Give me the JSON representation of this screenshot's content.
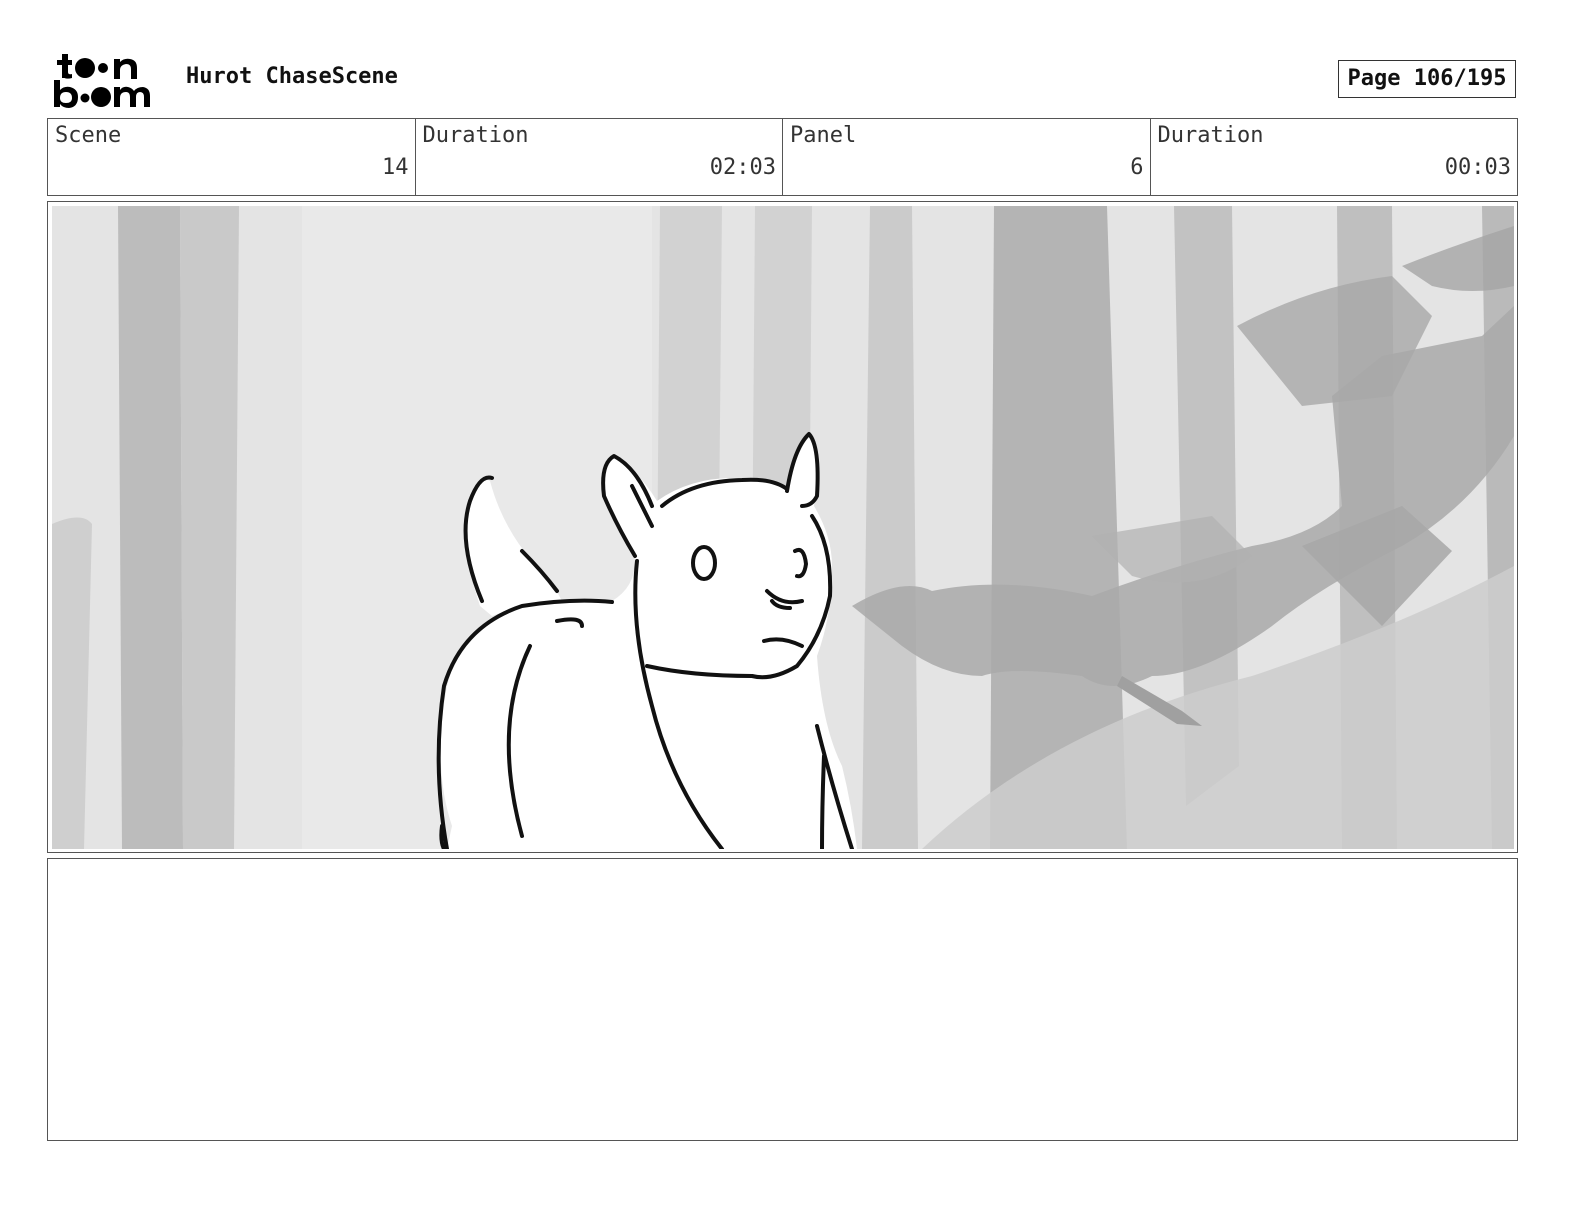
{
  "header": {
    "logo_text_top": "t●●n",
    "logo_text_bottom": "b●●m",
    "logo_name": "toon boom",
    "project_title": "Hurot ChaseScene",
    "page_label": "Page 106/195"
  },
  "info": [
    {
      "label": "Scene",
      "value": "14"
    },
    {
      "label": "Duration",
      "value": "02:03"
    },
    {
      "label": "Panel",
      "value": "6"
    },
    {
      "label": "Duration",
      "value": "00:03"
    }
  ],
  "panel": {
    "image_name": "forest-creature-sketch",
    "background_color": "#e4e4e4",
    "tree_color": "#bdbdbd",
    "dark_shape_color": "#a9a9a9"
  },
  "notes": {
    "text": ""
  }
}
